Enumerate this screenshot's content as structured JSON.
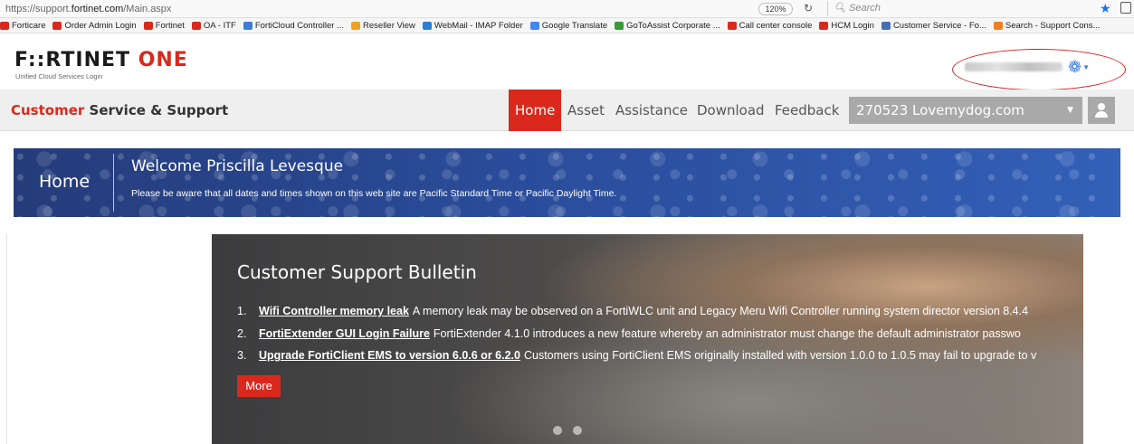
{
  "browser": {
    "url_prefix": "https://support.",
    "url_domain": "fortinet.com",
    "url_suffix": "/Main.aspx",
    "zoom": "120%",
    "reload_icon": "reload-icon",
    "search_placeholder": "Search",
    "bookmarks": [
      {
        "label": "Forticare",
        "color": "#da291c"
      },
      {
        "label": "Order Admin Login",
        "color": "#da291c"
      },
      {
        "label": "Fortinet",
        "color": "#da291c"
      },
      {
        "label": "OA - ITF",
        "color": "#da291c"
      },
      {
        "label": "FortiCloud Controller ...",
        "color": "#3b7dd8"
      },
      {
        "label": "Reseller View",
        "color": "#f0a020"
      },
      {
        "label": "WebMail - IMAP Folder",
        "color": "#2a7fd4"
      },
      {
        "label": "Google Translate",
        "color": "#4285f4"
      },
      {
        "label": "GoToAssist Corporate ...",
        "color": "#3a9a3a"
      },
      {
        "label": "Call center console",
        "color": "#da291c"
      },
      {
        "label": "HCM Login",
        "color": "#da291c"
      },
      {
        "label": "Customer Service - Fo...",
        "color": "#4a6fb0"
      },
      {
        "label": "Search - Support Cons...",
        "color": "#f08020"
      }
    ]
  },
  "header": {
    "logo_main": "F::RTINET",
    "logo_accent": "ONE",
    "logo_sub": "Unified Cloud Services Login"
  },
  "nav": {
    "brand_accent": "Customer",
    "brand_rest": " Service & Support",
    "items": [
      "Home",
      "Asset",
      "Assistance",
      "Download",
      "Feedback"
    ],
    "active": "Home",
    "account": "270523 Lovemydog.com"
  },
  "banner": {
    "section": "Home",
    "welcome": "Welcome Priscilla Levesque",
    "note": "Please be aware that all dates and times shown on this web site are Pacific Standard Time or Pacific Daylight Time."
  },
  "bulletin": {
    "title": "Customer Support Bulletin",
    "items": [
      {
        "num": "1.",
        "link": "Wifi Controller memory leak",
        "text": "A memory leak may be observed on a FortiWLC unit and Legacy Meru Wifi Controller running system director version 8.4.4"
      },
      {
        "num": "2.",
        "link": "FortiExtender GUI Login Failure",
        "text": "FortiExtender 4.1.0 introduces a new feature whereby an administrator must change the default administrator passwo"
      },
      {
        "num": "3.",
        "link": "Upgrade FortiClient EMS to version 6.0.6 or 6.2.0",
        "text": "Customers using FortiClient EMS originally installed with version 1.0.0 to 1.0.5 may fail to upgrade to v"
      }
    ],
    "more_label": "More",
    "slide_count": 2
  }
}
